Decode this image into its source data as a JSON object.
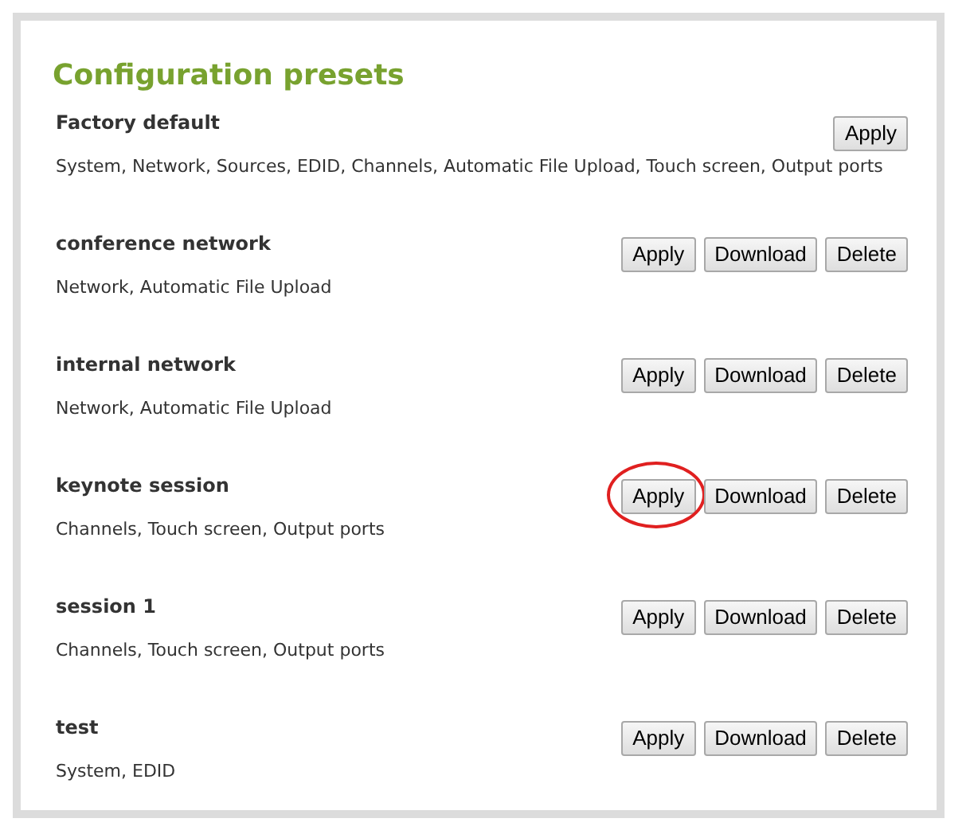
{
  "title": "Configuration presets",
  "presets": [
    {
      "name": "Factory default",
      "details": "System, Network, Sources, EDID, Channels, Automatic File Upload, Touch screen, Output ports",
      "buttons": [
        {
          "label": "Apply",
          "circled": false
        }
      ]
    },
    {
      "name": "conference network",
      "details": "Network, Automatic File Upload",
      "buttons": [
        {
          "label": "Apply",
          "circled": false
        },
        {
          "label": "Download",
          "circled": false
        },
        {
          "label": "Delete",
          "circled": false
        }
      ]
    },
    {
      "name": "internal network",
      "details": "Network, Automatic File Upload",
      "buttons": [
        {
          "label": "Apply",
          "circled": false
        },
        {
          "label": "Download",
          "circled": false
        },
        {
          "label": "Delete",
          "circled": false
        }
      ]
    },
    {
      "name": "keynote session",
      "details": "Channels, Touch screen, Output ports",
      "buttons": [
        {
          "label": "Apply",
          "circled": true
        },
        {
          "label": "Download",
          "circled": false
        },
        {
          "label": "Delete",
          "circled": false
        }
      ]
    },
    {
      "name": "session 1",
      "details": "Channels, Touch screen, Output ports",
      "buttons": [
        {
          "label": "Apply",
          "circled": false
        },
        {
          "label": "Download",
          "circled": false
        },
        {
          "label": "Delete",
          "circled": false
        }
      ]
    },
    {
      "name": "test",
      "details": "System, EDID",
      "buttons": [
        {
          "label": "Apply",
          "circled": false
        },
        {
          "label": "Download",
          "circled": false
        },
        {
          "label": "Delete",
          "circled": false
        }
      ]
    }
  ]
}
